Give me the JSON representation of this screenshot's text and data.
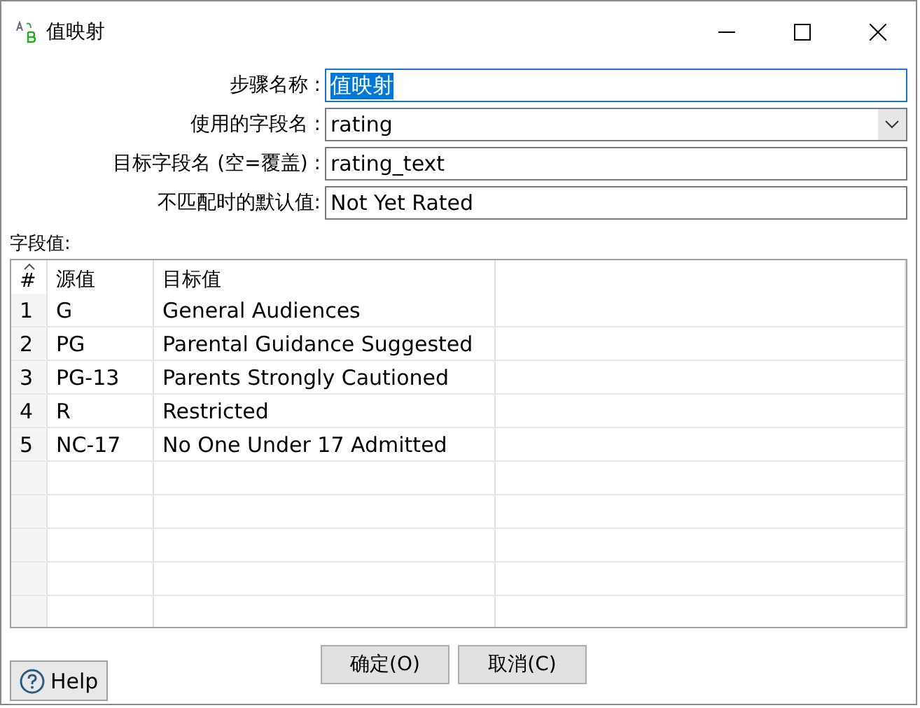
{
  "window": {
    "title": "值映射"
  },
  "fields": [
    {
      "label": "步骤名称 :",
      "kind": "text",
      "value": "值映射",
      "highlighted": true
    },
    {
      "label": "使用的字段名 :",
      "kind": "dropdown",
      "value": "rating",
      "highlighted": false
    },
    {
      "label": "目标字段名 (空=覆盖) :",
      "kind": "text",
      "value": "rating_text",
      "highlighted": false
    },
    {
      "label": "不匹配时的默认值:",
      "kind": "text",
      "value": "Not Yet Rated",
      "highlighted": false
    }
  ],
  "table_label": "字段值:",
  "table": {
    "columns": [
      "#",
      "源值",
      "目标值"
    ],
    "rows": [
      [
        "1",
        "G",
        "General Audiences"
      ],
      [
        "2",
        "PG",
        "Parental Guidance Suggested"
      ],
      [
        "3",
        "PG-13",
        "Parents Strongly Cautioned"
      ],
      [
        "4",
        "R",
        "Restricted"
      ],
      [
        "5",
        "NC-17",
        "No One Under 17 Admitted"
      ]
    ]
  },
  "buttons": [
    "确定(O)",
    "取消(C)"
  ],
  "help_button": "Help"
}
